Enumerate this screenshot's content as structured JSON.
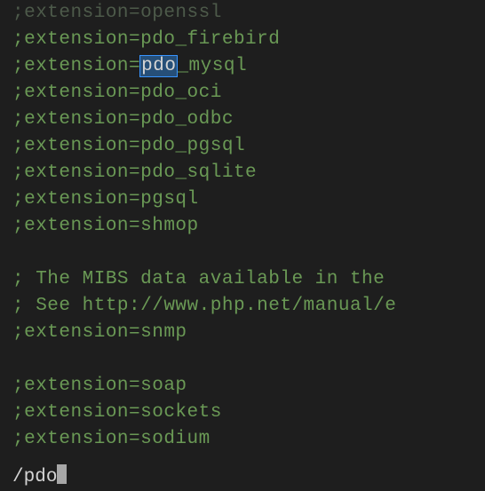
{
  "lines": {
    "l0": ";extension=openssl",
    "l1a": ";extension=",
    "l1b": "pdo",
    "l1c": "_firebird",
    "l2a": ";extension=",
    "l2b": "pdo",
    "l2c": "_mysql",
    "l3a": ";extension=",
    "l3b": "pdo",
    "l3c": "_oci",
    "l4a": ";extension=",
    "l4b": "pdo",
    "l4c": "_odbc",
    "l5a": ";extension=",
    "l5b": "pdo",
    "l5c": "_pgsql",
    "l6a": ";extension=",
    "l6b": "pdo",
    "l6c": "_sqlite",
    "l7": ";extension=pgsql",
    "l8": ";extension=shmop",
    "l9": "; The MIBS data available in the ",
    "l10": "; See http://www.php.net/manual/e",
    "l11": ";extension=snmp",
    "l12": ";extension=soap",
    "l13": ";extension=sockets",
    "l14": ";extension=sodium"
  },
  "search": {
    "prefix": "/",
    "query": "pdo"
  }
}
